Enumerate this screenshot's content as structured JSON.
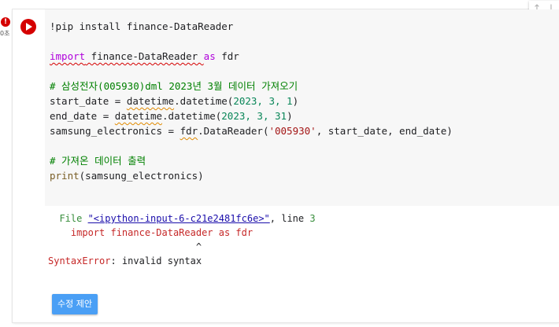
{
  "status": {
    "error_icon_label": "!",
    "elapsed": "0초"
  },
  "code": {
    "line1": "!pip install finance-DataReader",
    "line2_kw": "import",
    "line2_mid": " finance-DataReader ",
    "line2_as": "as",
    "line2_end": " fdr",
    "line3": "# 삼성전자(005930)dml 2023년 3월 데이터 가져오기",
    "line4_a": "start_date = ",
    "line4_fn": "datetime",
    "line4_b": ".datetime(",
    "line4_args": "2023, 3, 1",
    "line4_c": ")",
    "line5_a": "end_date = ",
    "line5_fn": "datetime",
    "line5_b": ".datetime(",
    "line5_args": "2023, 3, 31",
    "line5_c": ")",
    "line6_a": "samsung_electronics = ",
    "line6_fn": "fdr",
    "line6_b": ".DataReader(",
    "line6_str": "'005930'",
    "line6_c": ", start_date, end_date)",
    "line7": "# 가져온 데이터 출력",
    "line8_fn": "print",
    "line8_rest": "(samsung_electronics)"
  },
  "output": {
    "file_prefix": "  File ",
    "file_link": "\"<ipython-input-6-c21e2481fc6e>\"",
    "file_suffix": ", line ",
    "line_no": "3",
    "source_line": "    import finance-DataReader as fdr",
    "caret": "                          ^",
    "error_name": "SyntaxError",
    "error_msg": ": invalid syntax"
  },
  "buttons": {
    "suggest_fix": "수정 제안"
  },
  "toolbar": {
    "up_icon": "↑",
    "down_icon": "↓"
  }
}
